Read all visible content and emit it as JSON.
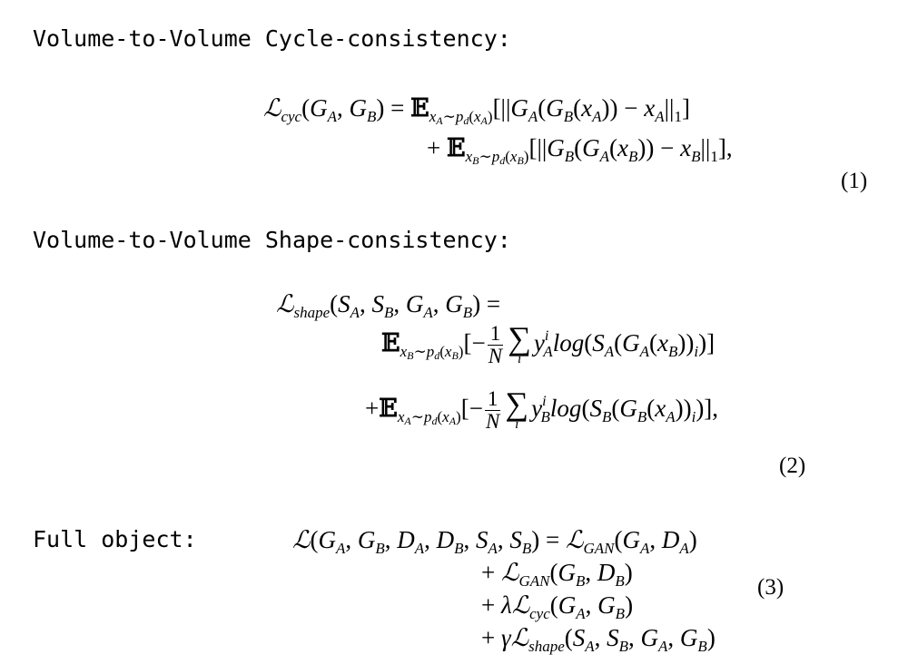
{
  "sections": {
    "cycle_heading": "Volume-to-Volume Cycle-consistency:",
    "shape_heading": "Volume-to-Volume Shape-consistency:",
    "full_heading": "Full object:"
  },
  "equation_numbers": {
    "eq1": "(1)",
    "eq2": "(2)",
    "eq3": "(3)"
  }
}
